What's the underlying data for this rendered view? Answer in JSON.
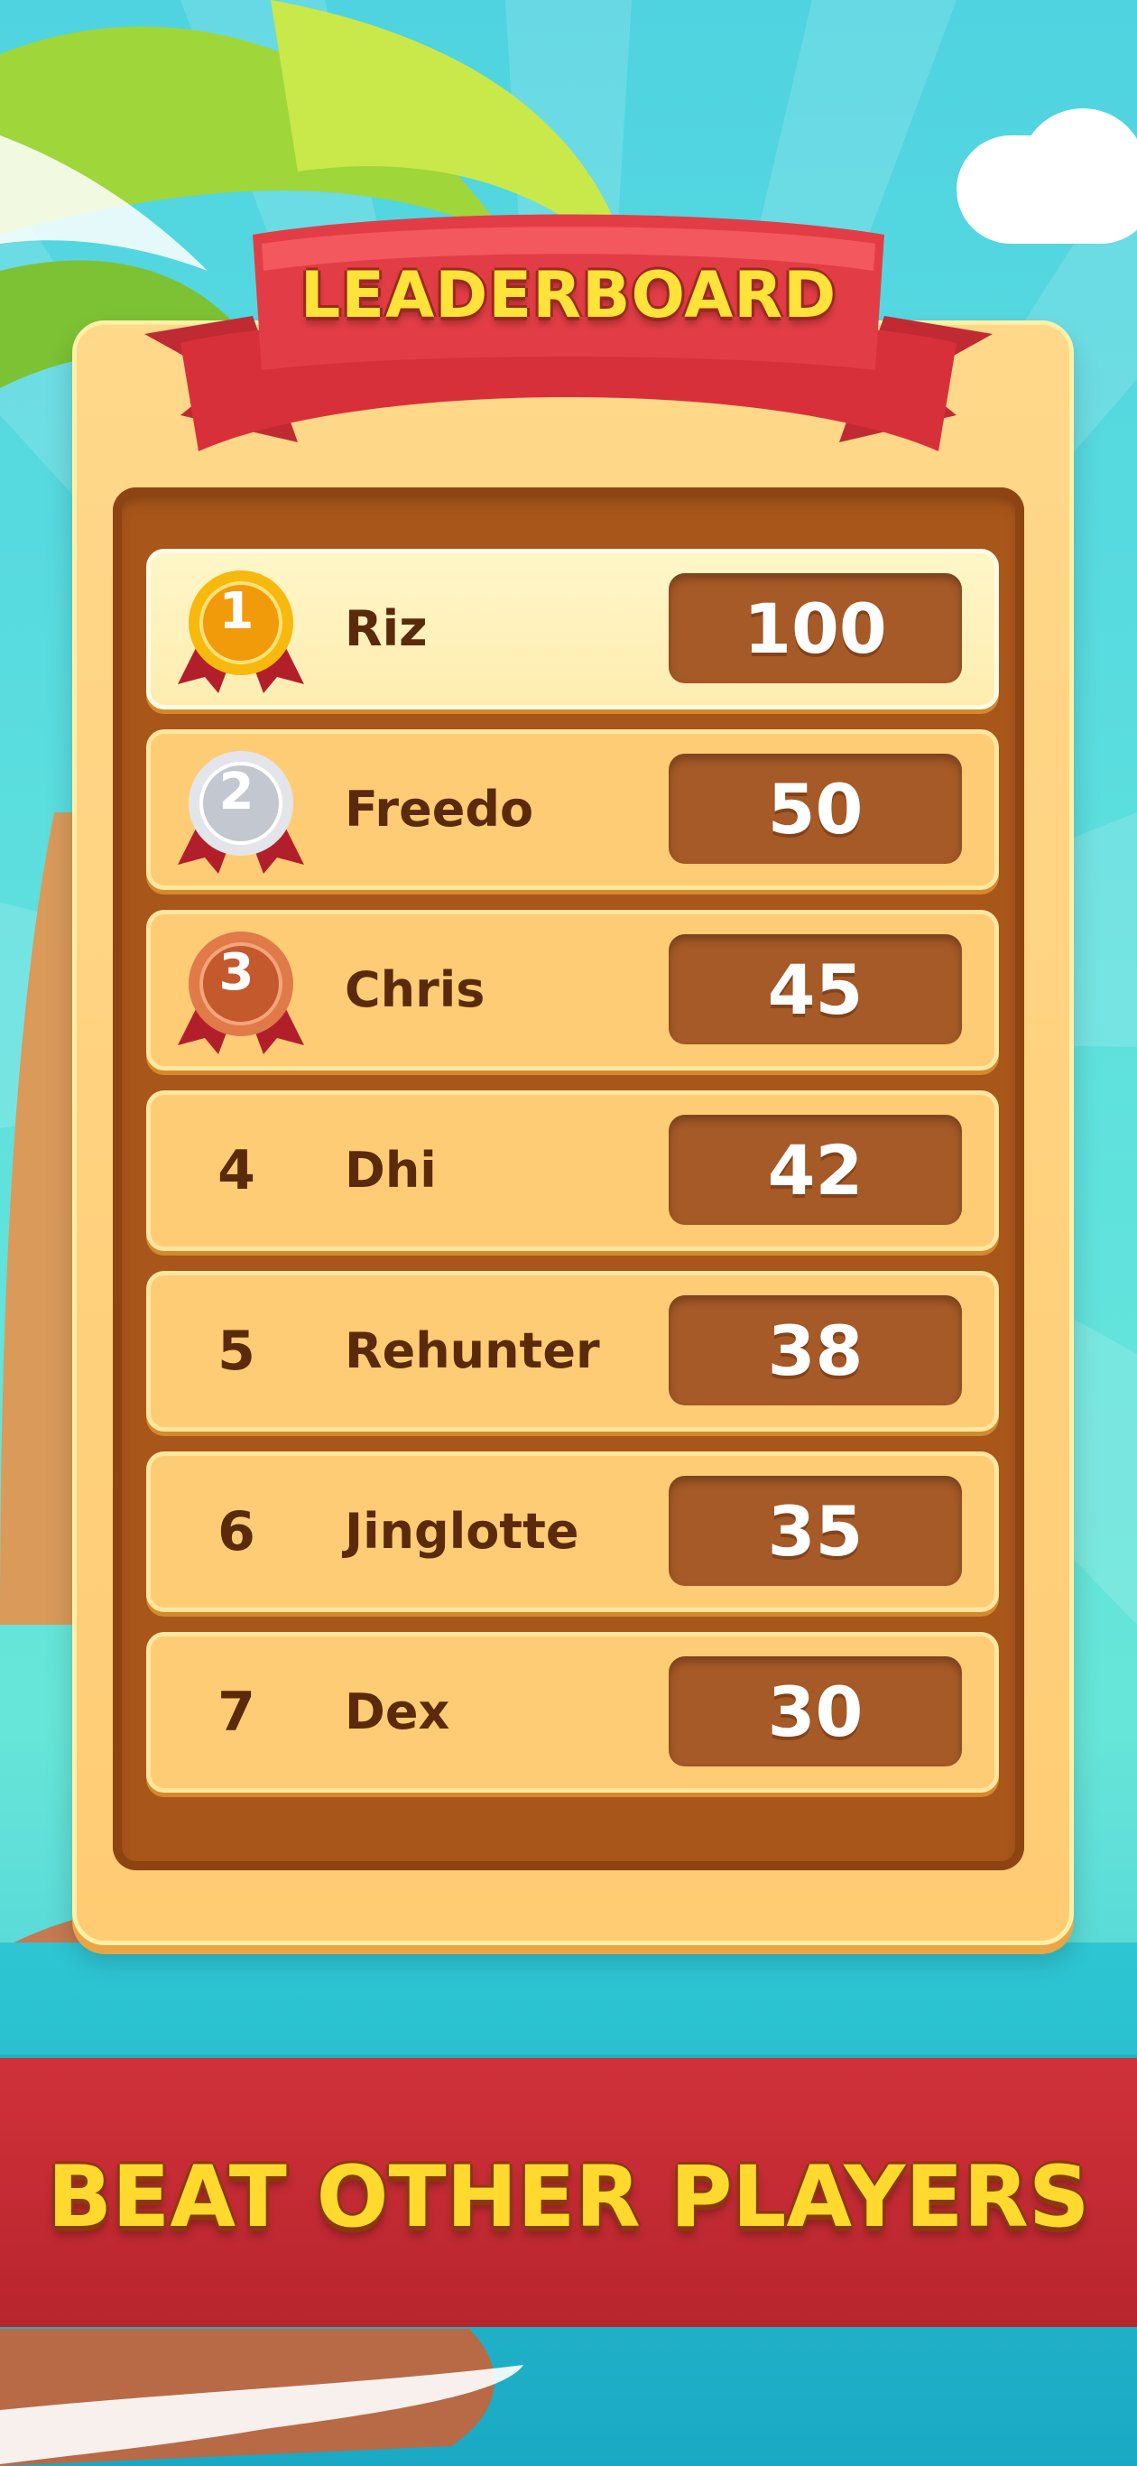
{
  "title": "LEADERBOARD",
  "tagline": "BEAT OTHER PLAYERS",
  "colors": {
    "gold": "#f5a50e",
    "silver": "#c9ccd1",
    "bronze": "#c9683a",
    "ribbon_red": "#d8303b",
    "score_box": "#a65a27"
  },
  "players": [
    {
      "rank": "1",
      "name": "Riz",
      "score": "100",
      "medal": "gold-medal-icon"
    },
    {
      "rank": "2",
      "name": "Freedo",
      "score": "50",
      "medal": "silver-medal-icon"
    },
    {
      "rank": "3",
      "name": "Chris",
      "score": "45",
      "medal": "bronze-medal-icon"
    },
    {
      "rank": "4",
      "name": "Dhi",
      "score": "42"
    },
    {
      "rank": "5",
      "name": "Rehunter",
      "score": "38"
    },
    {
      "rank": "6",
      "name": "Jinglotte",
      "score": "35"
    },
    {
      "rank": "7",
      "name": "Dex",
      "score": "30"
    }
  ]
}
